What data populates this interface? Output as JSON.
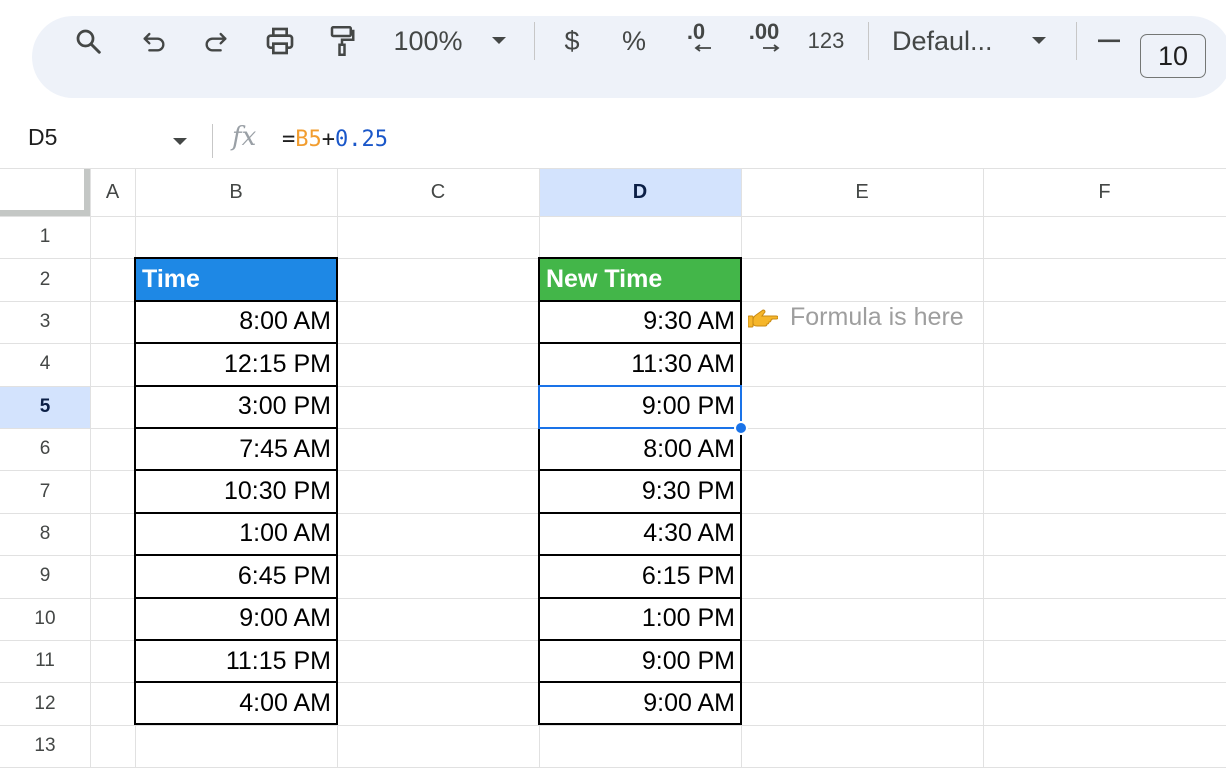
{
  "toolbar": {
    "zoom": "100%",
    "currency": "$",
    "percent": "%",
    "decrease_decimal": ".0",
    "increase_decimal": ".00",
    "number_format": "123",
    "font": "Defaul...",
    "minus": "−",
    "font_size": "10"
  },
  "formula_bar": {
    "name_box": "D5",
    "fx": "fx",
    "formula_eq": "=",
    "formula_ref": "B5",
    "formula_op": "+",
    "formula_num": "0.25"
  },
  "columns": [
    "A",
    "B",
    "C",
    "D",
    "E",
    "F"
  ],
  "selected_column": "D",
  "rows": [
    "1",
    "2",
    "3",
    "4",
    "5",
    "6",
    "7",
    "8",
    "9",
    "10",
    "11",
    "12",
    "13"
  ],
  "selected_row": "5",
  "table_time": {
    "header": "Time",
    "header_color": "#1e88e5",
    "values": [
      "8:00 AM",
      "12:15 PM",
      "3:00 PM",
      "7:45 AM",
      "10:30 PM",
      "1:00 AM",
      "6:45 PM",
      "9:00 AM",
      "11:15 PM",
      "4:00 AM"
    ]
  },
  "table_new_time": {
    "header": "New Time",
    "header_color": "#43b649",
    "values": [
      "9:30 AM",
      "11:30 AM",
      "9:00 PM",
      "8:00 AM",
      "9:30 PM",
      "4:30 AM",
      "6:15 PM",
      "1:00 PM",
      "9:00 PM",
      "9:00 AM"
    ]
  },
  "note": {
    "icon": "pointing-hand-icon",
    "text": "Formula is here"
  },
  "colors": {
    "selection": "#1a73e8",
    "header_selected_bg": "#d3e3fd",
    "toolbar_bg": "#eef2f9"
  }
}
